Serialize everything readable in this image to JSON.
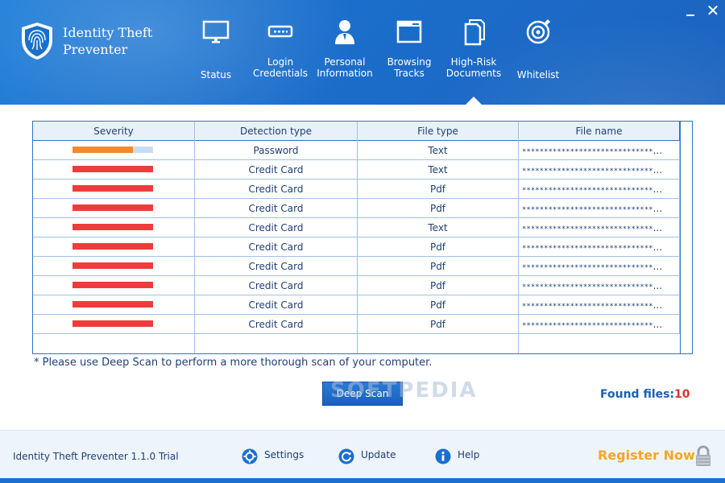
{
  "app": {
    "title_line1": "Identity Theft",
    "title_line2": "Preventer"
  },
  "nav": [
    {
      "id": "status",
      "label_line1": "",
      "label_line2": "Status",
      "icon": "monitor-icon"
    },
    {
      "id": "login",
      "label_line1": "Login",
      "label_line2": "Credentials",
      "icon": "password-field-icon"
    },
    {
      "id": "personal",
      "label_line1": "Personal",
      "label_line2": "Information",
      "icon": "person-icon"
    },
    {
      "id": "browsing",
      "label_line1": "Browsing",
      "label_line2": "Tracks",
      "icon": "browser-window-icon"
    },
    {
      "id": "highrisk",
      "label_line1": "High-Risk",
      "label_line2": "Documents",
      "icon": "documents-icon"
    },
    {
      "id": "whitelist",
      "label_line1": "",
      "label_line2": "Whitelist",
      "icon": "target-disc-icon"
    }
  ],
  "active_nav": "highrisk",
  "table": {
    "headers": [
      "Severity",
      "Detection type",
      "File type",
      "File name"
    ],
    "rows": [
      {
        "severity": 0.75,
        "severity_color": "#f08a2e",
        "detection": "Password",
        "filetype": "Text",
        "filename": "******************************"
      },
      {
        "severity": 1.0,
        "severity_color": "#ee3c3c",
        "detection": "Credit Card",
        "filetype": "Text",
        "filename": "******************************"
      },
      {
        "severity": 1.0,
        "severity_color": "#ee3c3c",
        "detection": "Credit Card",
        "filetype": "Pdf",
        "filename": "******************************"
      },
      {
        "severity": 1.0,
        "severity_color": "#ee3c3c",
        "detection": "Credit Card",
        "filetype": "Pdf",
        "filename": "******************************"
      },
      {
        "severity": 1.0,
        "severity_color": "#ee3c3c",
        "detection": "Credit Card",
        "filetype": "Text",
        "filename": "******************************"
      },
      {
        "severity": 1.0,
        "severity_color": "#ee3c3c",
        "detection": "Credit Card",
        "filetype": "Pdf",
        "filename": "******************************"
      },
      {
        "severity": 1.0,
        "severity_color": "#ee3c3c",
        "detection": "Credit Card",
        "filetype": "Pdf",
        "filename": "******************************"
      },
      {
        "severity": 1.0,
        "severity_color": "#ee3c3c",
        "detection": "Credit Card",
        "filetype": "Pdf",
        "filename": "******************************"
      },
      {
        "severity": 1.0,
        "severity_color": "#ee3c3c",
        "detection": "Credit Card",
        "filetype": "Pdf",
        "filename": "******************************"
      },
      {
        "severity": 1.0,
        "severity_color": "#ee3c3c",
        "detection": "Credit Card",
        "filetype": "Pdf",
        "filename": "******************************"
      }
    ],
    "overflow_marker": "..."
  },
  "note": "* Please use Deep Scan to perform a more thorough scan of your computer.",
  "deep_scan_label": "Deep Scan",
  "watermark": "SOFTPEDIA",
  "found": {
    "label": "Found files:",
    "count": "10"
  },
  "footer": {
    "version": "Identity Theft Preventer 1.1.0 Trial",
    "settings": "Settings",
    "update": "Update",
    "help": "Help",
    "register": "Register Now"
  },
  "colors": {
    "header_blue": "#1b6fcc",
    "accent_orange": "#f5a623",
    "count_red": "#d8342b"
  }
}
